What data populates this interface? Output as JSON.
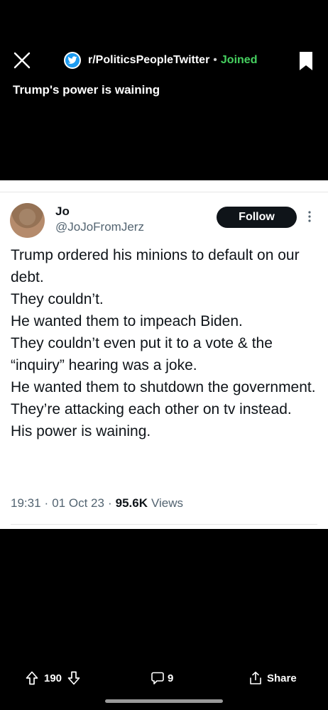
{
  "header": {
    "subreddit": "r/PoliticsPeopleTwitter",
    "separator": "•",
    "joined_label": "Joined",
    "post_title": "Trump's power is waining"
  },
  "tweet": {
    "name": "Jo",
    "handle": "@JoJoFromJerz",
    "follow_label": "Follow",
    "text": "Trump ordered his minions to default on our debt.\nThey couldn’t.\nHe wanted them to impeach Biden.\nThey couldn’t even put it to a vote & the “inquiry” hearing was a joke.\nHe wanted them to shutdown the government.\nThey’re attacking each other on tv instead.\nHis power is waining.",
    "time": "19:31",
    "dot": "·",
    "date": "01 Oct 23",
    "views_count": "95.6K",
    "views_label": "Views"
  },
  "actions": {
    "vote_count": "190",
    "comment_count": "9",
    "share_label": "Share"
  },
  "icons": {
    "close": "close-icon",
    "subreddit": "twitter-bird-icon",
    "bookmark": "bookmark-icon",
    "more": "more-vertical-icon",
    "upvote": "upvote-icon",
    "downvote": "downvote-icon",
    "comment": "comment-icon",
    "share": "share-icon"
  },
  "colors": {
    "background": "#000000",
    "joined": "#46d160",
    "twitter_blue": "#1d9bf0",
    "follow_button": "#0f1419",
    "secondary_text": "#536471"
  }
}
